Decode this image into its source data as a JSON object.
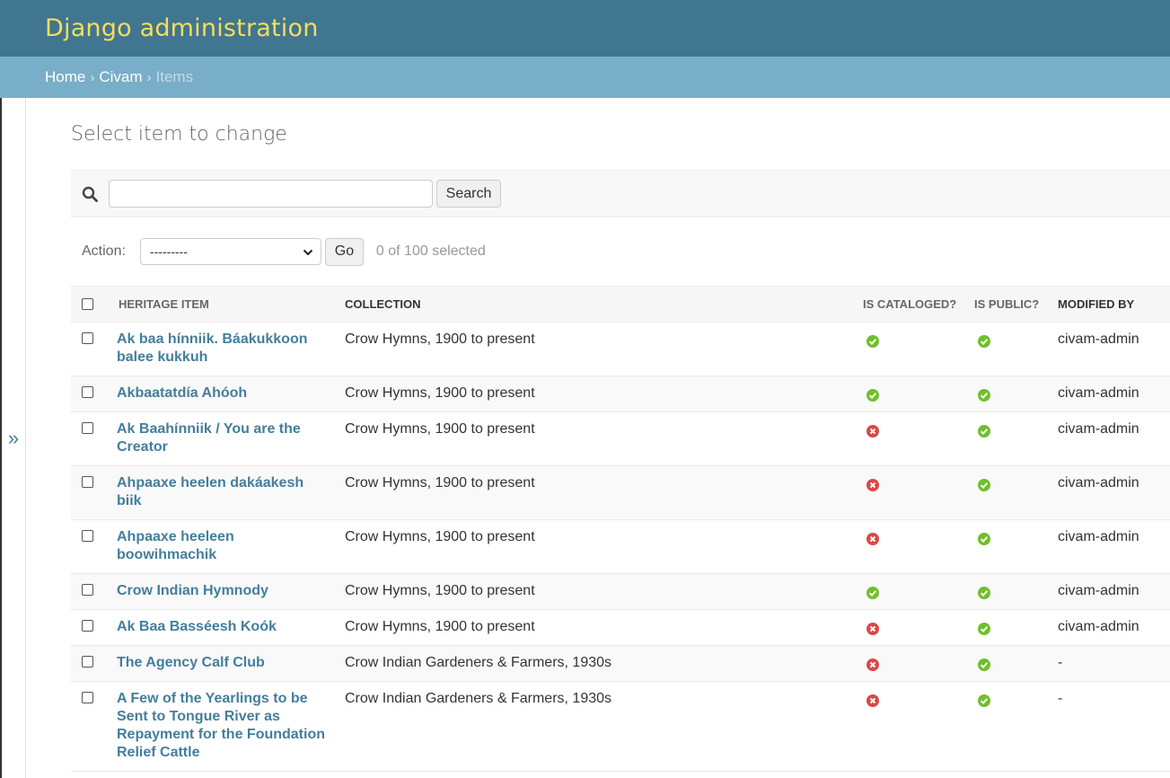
{
  "header": {
    "site_name": "Django administration"
  },
  "breadcrumbs": {
    "home": "Home",
    "app": "Civam",
    "current": "Items",
    "separator": "›"
  },
  "nav_toggle": {
    "label": "»"
  },
  "page": {
    "title": "Select item to change"
  },
  "search": {
    "value": "",
    "placeholder": "",
    "button_label": "Search"
  },
  "actions": {
    "label": "Action:",
    "selected_option": "---------",
    "go_label": "Go",
    "selected_count": "0 of 100 selected"
  },
  "table": {
    "columns": [
      "Heritage item",
      "Collection",
      "Is cataloged?",
      "Is public?",
      "Modified by"
    ],
    "rows": [
      {
        "item": "Ak baa hínniik. Báakukkoon balee kukkuh",
        "collection": "Crow Hymns, 1900 to present",
        "cataloged": true,
        "public": true,
        "modified_by": "civam-admin"
      },
      {
        "item": "Akbaatatdía Ahóoh",
        "collection": "Crow Hymns, 1900 to present",
        "cataloged": true,
        "public": true,
        "modified_by": "civam-admin"
      },
      {
        "item": "Ak Baahínniik / You are the Creator",
        "collection": "Crow Hymns, 1900 to present",
        "cataloged": false,
        "public": true,
        "modified_by": "civam-admin"
      },
      {
        "item": "Ahpaaxe heelen dakáakesh biik",
        "collection": "Crow Hymns, 1900 to present",
        "cataloged": false,
        "public": true,
        "modified_by": "civam-admin"
      },
      {
        "item": "Ahpaaxe heeleen boowihmachik",
        "collection": "Crow Hymns, 1900 to present",
        "cataloged": false,
        "public": true,
        "modified_by": "civam-admin"
      },
      {
        "item": "Crow Indian Hymnody",
        "collection": "Crow Hymns, 1900 to present",
        "cataloged": true,
        "public": true,
        "modified_by": "civam-admin"
      },
      {
        "item": "Ak Baa Basséesh Koók",
        "collection": "Crow Hymns, 1900 to present",
        "cataloged": false,
        "public": true,
        "modified_by": "civam-admin"
      },
      {
        "item": "The Agency Calf Club",
        "collection": "Crow Indian Gardeners & Farmers, 1930s",
        "cataloged": false,
        "public": true,
        "modified_by": "-"
      },
      {
        "item": "A Few of the Yearlings to be Sent to Tongue River as Repayment for the Foundation Relief Cattle",
        "collection": "Crow Indian Gardeners & Farmers, 1930s",
        "cataloged": false,
        "public": true,
        "modified_by": "-"
      }
    ]
  },
  "colors": {
    "header_bg": "#417690",
    "breadcrumb_bg": "#79aec8",
    "site_name": "#f5dd5d",
    "link": "#447e9b",
    "yes": "#70bf2b",
    "no": "#dd4646"
  },
  "icons": {
    "yes": "icon-yes",
    "no": "icon-no",
    "search": "search-icon",
    "dropdown": "chevron-down-icon"
  }
}
